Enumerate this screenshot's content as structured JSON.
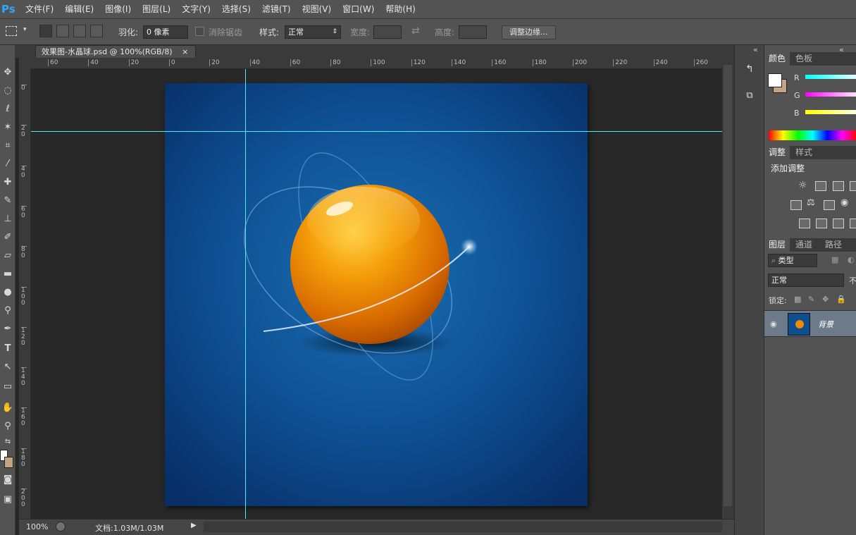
{
  "app": {
    "logo": "Ps"
  },
  "menu": [
    "文件(F)",
    "编辑(E)",
    "图像(I)",
    "图层(L)",
    "文字(Y)",
    "选择(S)",
    "滤镜(T)",
    "视图(V)",
    "窗口(W)",
    "帮助(H)"
  ],
  "options": {
    "feather_label": "羽化:",
    "feather_value": "0 像素",
    "antialias_label": "消除锯齿",
    "style_label": "样式:",
    "style_value": "正常",
    "width_label": "宽度:",
    "height_label": "高度:",
    "refine_edge_button": "调整边缘..."
  },
  "document": {
    "tab_title": "效果图-水晶球.psd @ 100%(RGB/8)",
    "tab_close": "×",
    "ruler_top_labels": [
      "60",
      "40",
      "20",
      "0",
      "20",
      "40",
      "60",
      "80",
      "100",
      "120",
      "140",
      "160",
      "180",
      "200",
      "220",
      "240",
      "260"
    ],
    "ruler_left_labels": [
      "0",
      "2 0",
      "4 0",
      "6 0",
      "8 0",
      "1 0 0",
      "1 2 0",
      "1 4 0",
      "1 6 0",
      "1 8 0",
      "2 0 0"
    ],
    "colors": {
      "canvas_bg": "#0b4a8c",
      "sphere": "#f08a00",
      "guide": "#4ee9ff"
    }
  },
  "status": {
    "zoom": "100%",
    "doc_info": "文档:1.03M/1.03M"
  },
  "panels": {
    "collapse_glyph": "«",
    "color_tabs": [
      "颜色",
      "色板"
    ],
    "channels": [
      "R",
      "G",
      "B"
    ],
    "adjust_tabs": [
      "调整",
      "样式"
    ],
    "adjust_title": "添加调整",
    "layer_tabs": [
      "图层",
      "通道",
      "路径"
    ],
    "filter_kind": "类型",
    "blend_mode": "正常",
    "opacity_trunc": "不",
    "lock_label": "锁定:",
    "layer_name": "背景"
  }
}
